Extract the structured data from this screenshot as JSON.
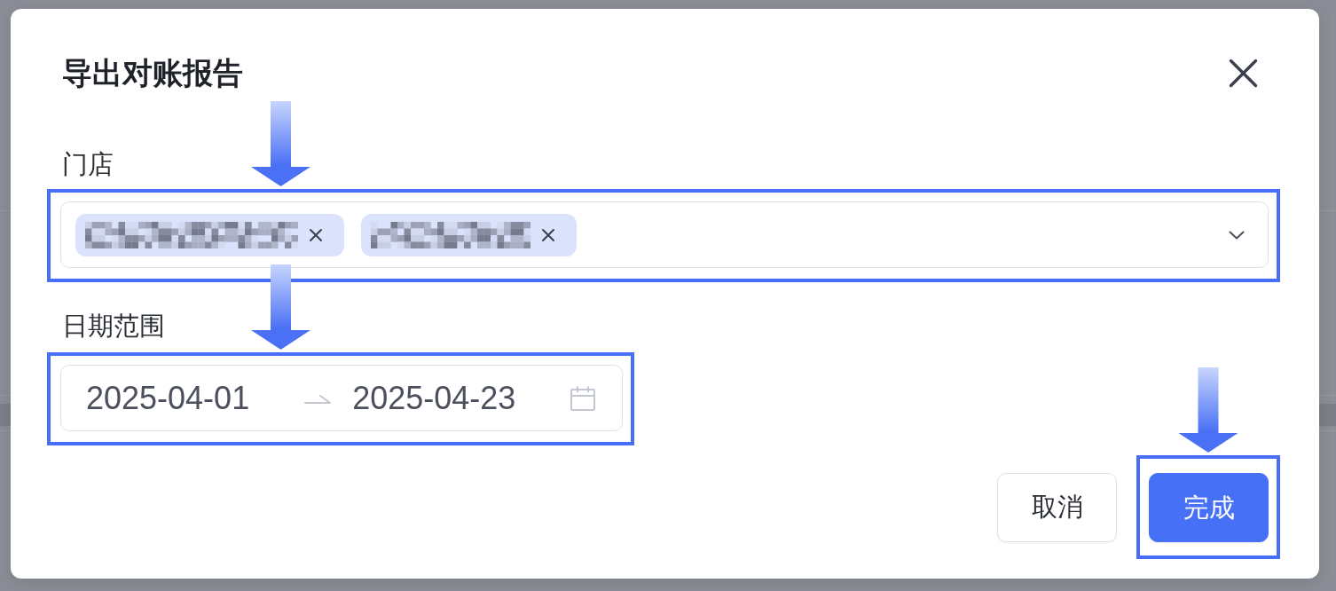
{
  "dialog": {
    "title": "导出对账报告"
  },
  "fields": [
    {
      "kind": "multi_select",
      "label": "门店",
      "tags": [
        {
          "kind": "redacted"
        },
        {
          "kind": "redacted"
        }
      ],
      "highlighted": true
    },
    {
      "kind": "date_range",
      "label": "日期范围",
      "start": "2025-04-01",
      "end": "2025-04-23",
      "highlighted": true
    }
  ],
  "buttons": [
    {
      "kind": "default",
      "label": "取消",
      "highlighted": false
    },
    {
      "kind": "primary",
      "label": "完成",
      "highlighted": true
    }
  ]
}
